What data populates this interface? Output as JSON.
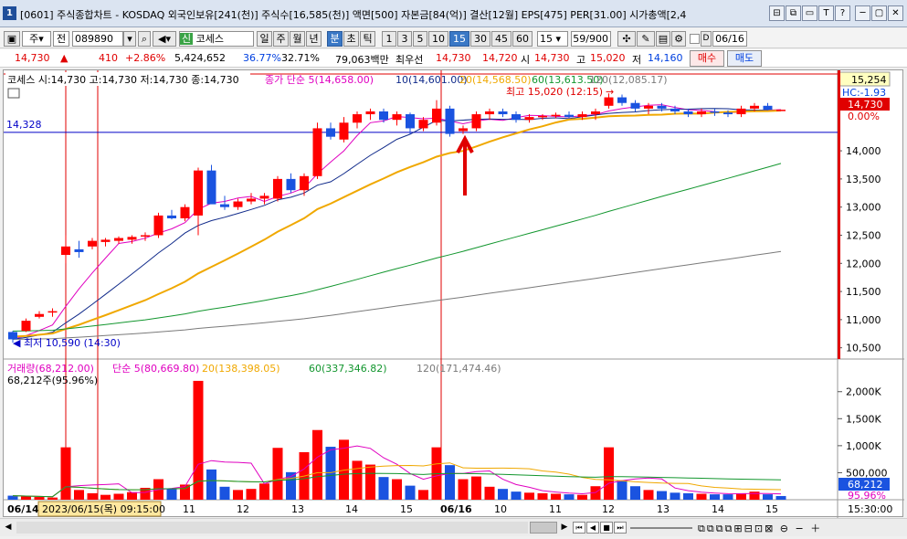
{
  "window": {
    "badge": "1",
    "title": "[0601] 주식종합차트 - KOSDAQ 외국인보유[241(천)] 주식수[16,585(천)] 액면[500] 자본금[84(억)] 결산[12월] EPS[475] PER[31.00] 시가총액[2,4",
    "buttons": [
      "⊟",
      "⧉",
      "▭",
      "T",
      "?",
      "─",
      "▢",
      "✕"
    ]
  },
  "toolbar": {
    "market": "주",
    "scope": "전",
    "code": "089890",
    "name_badge": "신",
    "name": "코세스",
    "periods": [
      "일",
      "주",
      "월",
      "년",
      "분",
      "초",
      "틱"
    ],
    "active_period": "분",
    "intervals": [
      "1",
      "3",
      "5",
      "10",
      "15",
      "30",
      "45",
      "60"
    ],
    "active_interval": "15",
    "interval_value": "15",
    "count": "59/900",
    "date": "06/16"
  },
  "quote": {
    "price": "14,730",
    "arrow": "▲",
    "change": "410",
    "change_pct": "+2.86%",
    "volume": "5,424,652",
    "ratio1": "36.77%",
    "ratio2": "32.71%",
    "amount": "79,063백만",
    "best_label": "최우선",
    "best_ask": "14,730",
    "best_bid": "14,720",
    "open_label": "시",
    "open": "14,730",
    "high_label": "고",
    "high": "15,020",
    "low_label": "저",
    "low": "14,160",
    "buy_label": "매수",
    "sell_label": "매도"
  },
  "colors": {
    "up": "#ff0000",
    "down": "#1a53e0",
    "ma5": "#e000c0",
    "ma10": "#102a8a",
    "ma20": "#f0a800",
    "ma60": "#12962e",
    "ma120": "#7a7a7a"
  },
  "chart": {
    "header": "코세스 시:14,730 고:14,730 저:14,730 종:14,730",
    "ma_legend": [
      {
        "text": "종가 단순 5(14,658.00)",
        "color": "#e000c0"
      },
      {
        "text": "10(14,601.00)",
        "color": "#102a8a"
      },
      {
        "text": "20(14,568.50)",
        "color": "#f0a800"
      },
      {
        "text": "60(13,613.50)",
        "color": "#12962e"
      },
      {
        "text": "120(12,085.17)",
        "color": "#7a7a7a"
      }
    ],
    "hline_label": "14,328",
    "high_annotation": "최고 15,020 (12:15)",
    "low_annotation": "최저 10,590 (14:30)",
    "right_labels": [
      "15,254",
      "HC:-1.93",
      "14,730",
      "0.00%"
    ],
    "price_ticks": [
      "14,000",
      "13,500",
      "13,000",
      "12,500",
      "12,000",
      "11,500",
      "11,000",
      "10,500"
    ],
    "vol_legend": [
      {
        "text": "거래량(68,212.00)",
        "color": "#e000c0"
      },
      {
        "text": "단순 5(80,669.80)",
        "color": "#e000c0"
      },
      {
        "text": "20(138,398.05)",
        "color": "#f0a800"
      },
      {
        "text": "60(337,346.82)",
        "color": "#12962e"
      },
      {
        "text": "120(171,474.46)",
        "color": "#7a7a7a"
      }
    ],
    "vol_sub": "68,212주(95.96%)",
    "vol_ticks": [
      "2,000K",
      "1,500K",
      "1,000K",
      "500,000"
    ],
    "vol_right_labels": [
      "68,212",
      "95.96%"
    ],
    "time_labels": [
      "06/14",
      "11",
      "12",
      "13",
      "14",
      "15",
      "06/16",
      "10",
      "11",
      "12",
      "13",
      "14",
      "15"
    ],
    "cursor_time": "2023/06/15(목) 09:15:00",
    "end_time": "15:30:00"
  },
  "chart_data": {
    "type": "candlestick",
    "symbol": "코세스",
    "interval": "15분",
    "ylim": [
      10300,
      15300
    ],
    "vol_ylim": [
      0,
      2300000
    ],
    "candles": [
      [
        10780,
        10800,
        10590,
        10650
      ],
      [
        10800,
        11020,
        10780,
        10980
      ],
      [
        11050,
        11150,
        11020,
        11100
      ],
      [
        11150,
        11200,
        11050,
        11150
      ],
      [
        12150,
        12500,
        12000,
        12300
      ],
      [
        12250,
        12400,
        12100,
        12200
      ],
      [
        12300,
        12450,
        12250,
        12400
      ],
      [
        12380,
        12450,
        12300,
        12420
      ],
      [
        12400,
        12480,
        12350,
        12450
      ],
      [
        12420,
        12500,
        12350,
        12470
      ],
      [
        12480,
        12550,
        12400,
        12500
      ],
      [
        12500,
        12900,
        12450,
        12850
      ],
      [
        12850,
        12950,
        12780,
        12800
      ],
      [
        12800,
        13050,
        12750,
        13000
      ],
      [
        12850,
        13700,
        12500,
        13650
      ],
      [
        13650,
        13750,
        13100,
        13050
      ],
      [
        13050,
        13200,
        12950,
        13000
      ],
      [
        13000,
        13150,
        12950,
        13100
      ],
      [
        13100,
        13250,
        13050,
        13150
      ],
      [
        13150,
        13250,
        13050,
        13200
      ],
      [
        13150,
        13550,
        13100,
        13500
      ],
      [
        13500,
        13600,
        13250,
        13300
      ],
      [
        13300,
        13600,
        13200,
        13550
      ],
      [
        13550,
        14500,
        13500,
        14400
      ],
      [
        14400,
        14500,
        14200,
        14250
      ],
      [
        14200,
        14600,
        14150,
        14500
      ],
      [
        14500,
        14700,
        14400,
        14650
      ],
      [
        14650,
        14750,
        14550,
        14700
      ],
      [
        14700,
        14750,
        14500,
        14550
      ],
      [
        14550,
        14700,
        14450,
        14650
      ],
      [
        14650,
        14680,
        14300,
        14400
      ],
      [
        14400,
        14600,
        14350,
        14550
      ],
      [
        14500,
        14900,
        14450,
        14750
      ],
      [
        14750,
        14800,
        14250,
        14300
      ],
      [
        14350,
        14450,
        14300,
        14400
      ],
      [
        14400,
        14700,
        14350,
        14650
      ],
      [
        14650,
        14750,
        14550,
        14700
      ],
      [
        14700,
        14750,
        14600,
        14650
      ],
      [
        14650,
        14700,
        14500,
        14550
      ],
      [
        14550,
        14650,
        14500,
        14600
      ],
      [
        14600,
        14650,
        14550,
        14620
      ],
      [
        14620,
        14680,
        14580,
        14640
      ],
      [
        14640,
        14700,
        14580,
        14600
      ],
      [
        14600,
        14700,
        14550,
        14650
      ],
      [
        14650,
        14750,
        14550,
        14700
      ],
      [
        14800,
        15020,
        14750,
        14950
      ],
      [
        14950,
        15000,
        14800,
        14850
      ],
      [
        14850,
        14900,
        14700,
        14750
      ],
      [
        14750,
        14850,
        14650,
        14800
      ],
      [
        14800,
        14850,
        14700,
        14750
      ],
      [
        14750,
        14800,
        14650,
        14700
      ],
      [
        14700,
        14750,
        14600,
        14650
      ],
      [
        14650,
        14750,
        14600,
        14700
      ],
      [
        14700,
        14750,
        14620,
        14680
      ],
      [
        14680,
        14720,
        14600,
        14650
      ],
      [
        14650,
        14800,
        14600,
        14750
      ],
      [
        14750,
        14850,
        14700,
        14800
      ],
      [
        14800,
        14850,
        14720,
        14730
      ],
      [
        14730,
        14730,
        14730,
        14730
      ]
    ],
    "volume": [
      75000,
      60000,
      50000,
      40000,
      970000,
      180000,
      120000,
      90000,
      110000,
      140000,
      220000,
      380000,
      200000,
      280000,
      2200000,
      560000,
      240000,
      180000,
      200000,
      300000,
      960000,
      510000,
      880000,
      1290000,
      980000,
      1110000,
      720000,
      650000,
      420000,
      380000,
      260000,
      180000,
      970000,
      640000,
      380000,
      430000,
      240000,
      200000,
      150000,
      130000,
      120000,
      110000,
      100000,
      90000,
      250000,
      970000,
      360000,
      250000,
      180000,
      160000,
      130000,
      120000,
      110000,
      100000,
      100000,
      120000,
      150000,
      100000,
      68212
    ],
    "vol_up": [
      false,
      true,
      true,
      true,
      true,
      true,
      true,
      true,
      true,
      true,
      true,
      true,
      false,
      true,
      true,
      false,
      false,
      true,
      true,
      true,
      true,
      false,
      true,
      true,
      false,
      true,
      true,
      true,
      false,
      true,
      false,
      true,
      true,
      false,
      true,
      true,
      true,
      false,
      false,
      true,
      true,
      true,
      false,
      true,
      true,
      true,
      false,
      false,
      true,
      false,
      false,
      false,
      true,
      false,
      false,
      true,
      true,
      false,
      false
    ],
    "high": {
      "price": 15020,
      "time": "12:15"
    },
    "low": {
      "price": 10590,
      "time": "14:30"
    },
    "ref_line": 14328
  }
}
